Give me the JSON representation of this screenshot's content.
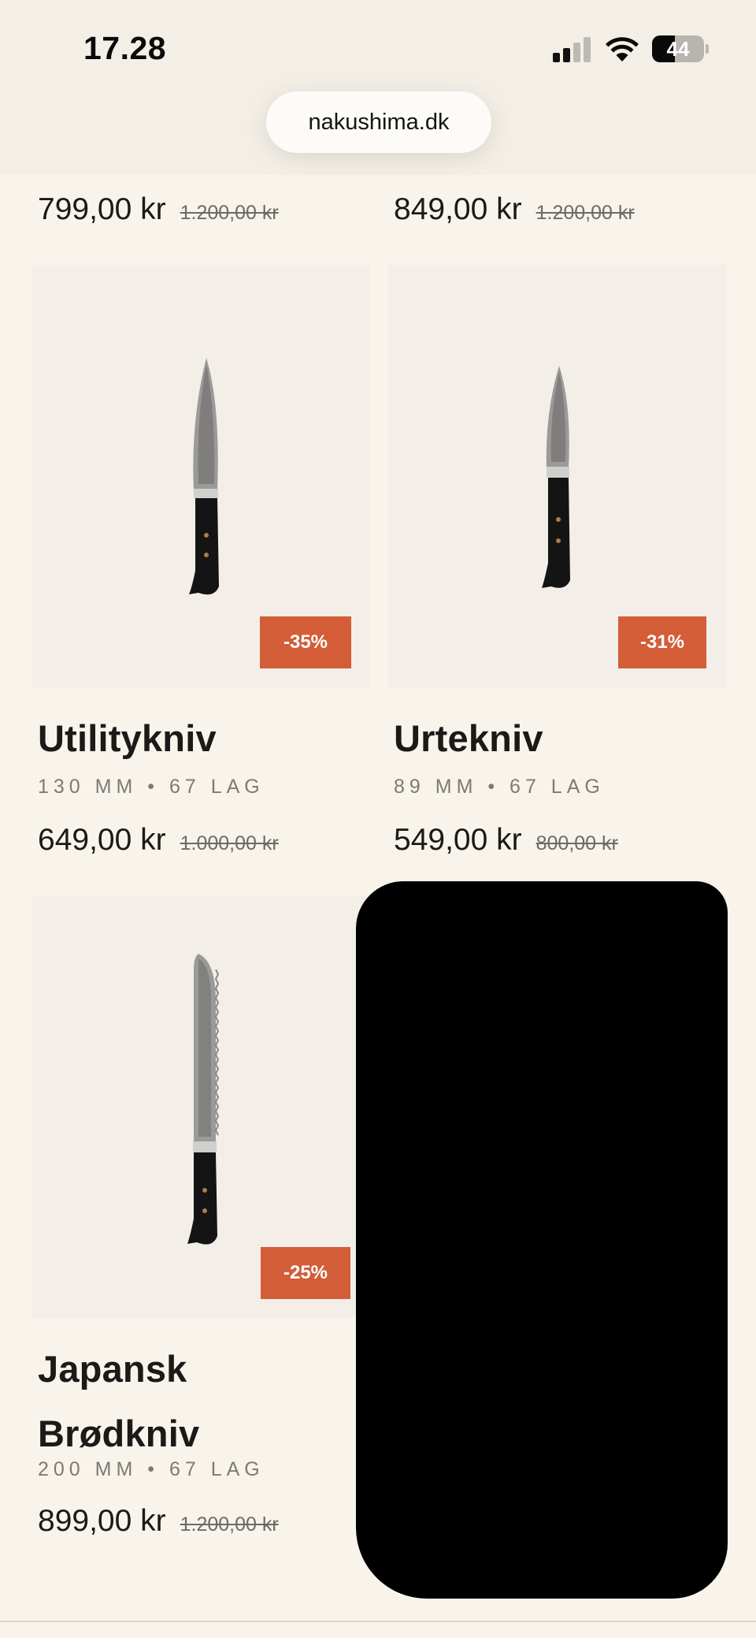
{
  "status_bar": {
    "time": "17.28",
    "battery": "44",
    "battery_level": 0.44
  },
  "browser": {
    "url": "nakushima.dk"
  },
  "top_prices": [
    {
      "price": "799,00 kr",
      "old_price": "1.200,00 kr"
    },
    {
      "price": "849,00 kr",
      "old_price": "1.200,00 kr"
    }
  ],
  "products": [
    {
      "title": "Utilitykniv",
      "spec": "130 MM • 67 LAG",
      "price": "649,00 kr",
      "old_price": "1.000,00 kr",
      "badge": "-35%"
    },
    {
      "title": "Urtekniv",
      "spec": "89 MM • 67 LAG",
      "price": "549,00 kr",
      "old_price": "800,00 kr",
      "badge": "-31%"
    },
    {
      "title_line1": "Japansk",
      "title_line2": "Brødkniv",
      "spec": "200 MM • 67 LAG",
      "price": "899,00 kr",
      "old_price": "1.200,00 kr",
      "badge": "-25%"
    }
  ],
  "colors": {
    "page_bg": "#f8f4ec",
    "card_bg": "#f3efe8",
    "badge": "#d35d37",
    "text": "#1b1a18",
    "muted": "#7d7a74"
  }
}
